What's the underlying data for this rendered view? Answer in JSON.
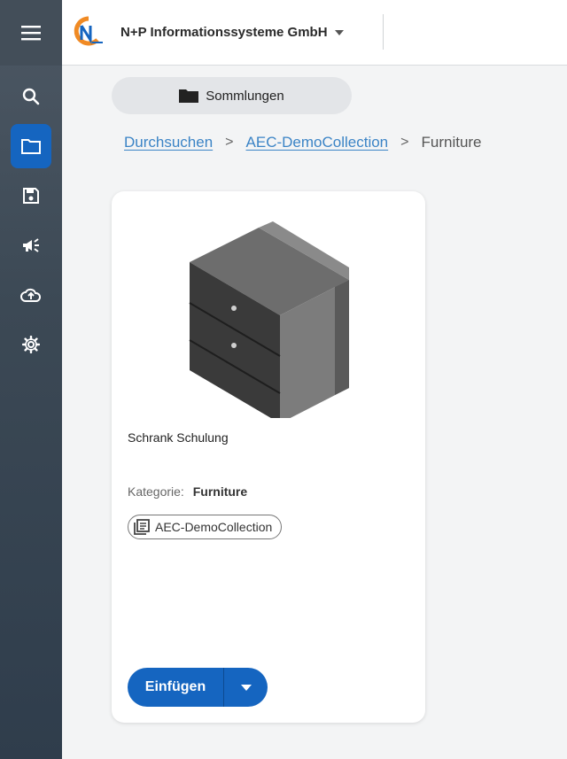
{
  "header": {
    "org_name": "N+P Informationssysteme GmbH",
    "logo_icon": "np-logo-icon",
    "caret_icon": "caret-down-icon"
  },
  "sidebar": {
    "menu_icon": "hamburger-menu-icon",
    "items": [
      {
        "icon": "search-icon",
        "active": false
      },
      {
        "icon": "folder-icon",
        "active": true
      },
      {
        "icon": "save-icon",
        "active": false
      },
      {
        "icon": "broadcast-icon",
        "active": false
      },
      {
        "icon": "cloud-upload-icon",
        "active": false
      },
      {
        "icon": "gear-icon",
        "active": false
      }
    ]
  },
  "collections_button": {
    "label": "Sommlungen",
    "icon": "folder-icon"
  },
  "breadcrumb": {
    "items": [
      "Durchsuchen",
      "AEC-DemoCollection",
      "Furniture"
    ],
    "separator": ">"
  },
  "card": {
    "title": "Schrank Schulung",
    "category_label": "Kategorie:",
    "category_value": "Furniture",
    "chip_label": "AEC-DemoCollection",
    "chip_icon": "library-icon",
    "insert_label": "Einfügen",
    "dropdown_icon": "caret-down-icon"
  },
  "colors": {
    "accent": "#1565c0",
    "link": "#3b84c6",
    "sidebar": "#3c4955"
  }
}
